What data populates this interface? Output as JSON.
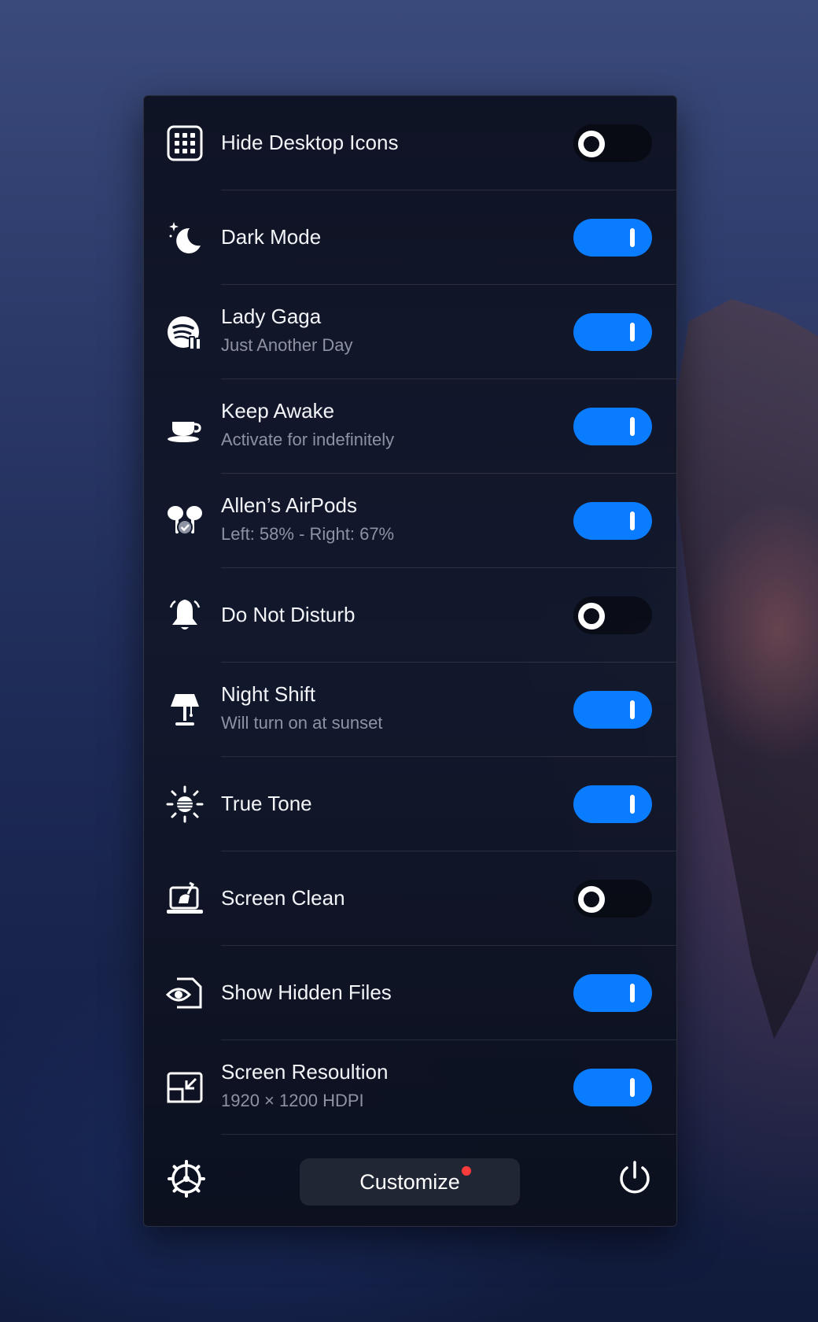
{
  "rows": [
    {
      "title": "Hide Desktop Icons",
      "subtitle": "",
      "icon": "desktop-grid-icon",
      "enabled": false
    },
    {
      "title": "Dark Mode",
      "subtitle": "",
      "icon": "moon-stars-icon",
      "enabled": true
    },
    {
      "title": "Lady Gaga",
      "subtitle": "Just Another Day",
      "icon": "spotify-icon",
      "enabled": true
    },
    {
      "title": "Keep Awake",
      "subtitle": "Activate for indefinitely",
      "icon": "coffee-cup-icon",
      "enabled": true
    },
    {
      "title": "Allen’s AirPods",
      "subtitle": "Left: 58% - Right: 67%",
      "icon": "airpods-icon",
      "enabled": true
    },
    {
      "title": "Do Not Disturb",
      "subtitle": "",
      "icon": "bell-icon",
      "enabled": false
    },
    {
      "title": "Night Shift",
      "subtitle": "Will turn on at sunset",
      "icon": "lamp-icon",
      "enabled": true
    },
    {
      "title": "True Tone",
      "subtitle": "",
      "icon": "sun-icon",
      "enabled": true
    },
    {
      "title": "Screen Clean",
      "subtitle": "",
      "icon": "laptop-brush-icon",
      "enabled": false
    },
    {
      "title": "Show Hidden Files",
      "subtitle": "",
      "icon": "eye-file-icon",
      "enabled": true
    },
    {
      "title": "Screen Resoultion",
      "subtitle": "1920 × 1200 HDPI",
      "icon": "resize-screen-icon",
      "enabled": true
    }
  ],
  "footer": {
    "settings_icon": "gear-icon",
    "customize_label": "Customize",
    "notification_badge_color": "#ff3b3b",
    "power_icon": "power-icon"
  },
  "colors": {
    "toggle_on": "#0a7cff",
    "toggle_off": "#000000",
    "title_text": "#f2f4f8",
    "subtitle_text": "#8e93a3"
  }
}
